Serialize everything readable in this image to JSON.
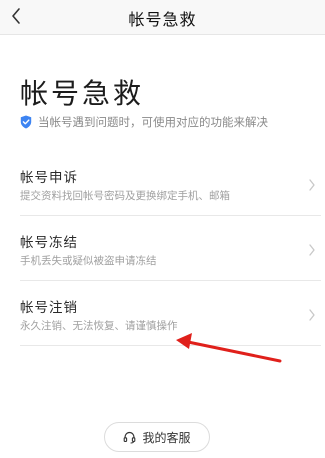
{
  "nav": {
    "title": "帐号急救"
  },
  "page": {
    "title": "帐号急救",
    "subtitle": "当帐号遇到问题时，可使用对应的功能来解决"
  },
  "menu": {
    "items": [
      {
        "title": "帐号申诉",
        "desc": "提交资料找回帐号密码及更换绑定手机、邮箱"
      },
      {
        "title": "帐号冻结",
        "desc": "手机丢失或疑似被盗申请冻结"
      },
      {
        "title": "帐号注销",
        "desc": "永久注销、无法恢复、请谨慎操作"
      }
    ]
  },
  "support": {
    "label": "我的客服"
  },
  "colors": {
    "shield": "#3d84f2",
    "annotation_arrow": "#e0201b",
    "chevron": "#c8c8c8"
  }
}
